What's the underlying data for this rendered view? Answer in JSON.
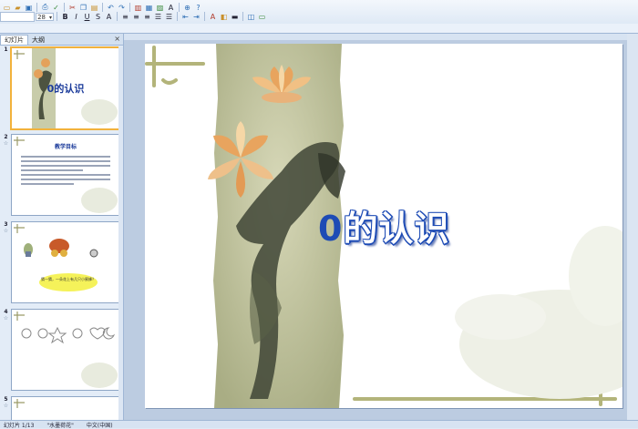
{
  "ribbon": {
    "font_name": "",
    "font_size": "28"
  },
  "panel": {
    "tabs": [
      "幻灯片",
      "大纲"
    ],
    "close": "×"
  },
  "thumbnails": [
    {
      "number": "1",
      "title": "0的认识",
      "selected": true
    },
    {
      "number": "2",
      "title": "教学目标",
      "selected": false
    },
    {
      "number": "3",
      "title": "",
      "selected": false,
      "bubble": "猜一猜，一朵花上有几只小蜜蜂？"
    },
    {
      "number": "4",
      "title": "",
      "selected": false
    },
    {
      "number": "5",
      "title": "",
      "selected": false
    }
  ],
  "slide": {
    "title": "0的认识",
    "title_zero": "0",
    "title_rest": "的认识"
  },
  "status": {
    "slide_info": "幻灯片 1/13",
    "theme": "\"水墨荷花\"",
    "language": "中文(中国)"
  },
  "colors": {
    "title_blue": "#1d4bb5",
    "ribbon_bg": "#dfe9f5",
    "selected_border": "#f2b23c"
  }
}
